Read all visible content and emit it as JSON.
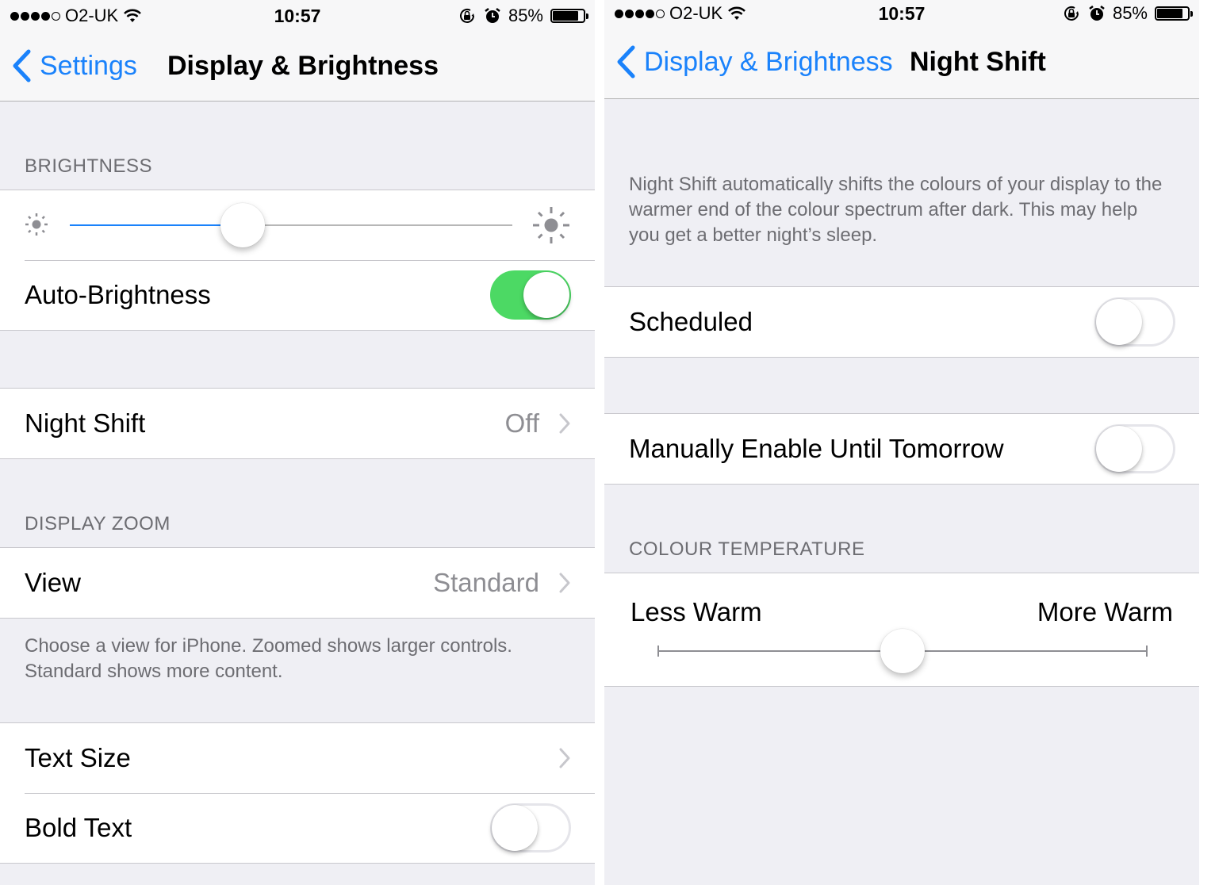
{
  "colors": {
    "accent": "#1a82fb",
    "toggle_on": "#4cd964",
    "background": "#efeff4",
    "secondary_text": "#8e8e93",
    "header_text": "#6d6d72"
  },
  "left_screen": {
    "status_bar": {
      "signal_bars": 4,
      "signal_max": 5,
      "carrier": "O2-UK",
      "wifi_icon": "wifi-icon",
      "time": "10:57",
      "rotation_lock_icon": "rotation-lock-icon",
      "alarm_icon": "alarm-icon",
      "battery_percent": "85%",
      "battery_level": 0.85
    },
    "nav": {
      "back_label": "Settings",
      "title": "Display & Brightness"
    },
    "brightness": {
      "header": "BRIGHTNESS",
      "slider_value": 0.39,
      "min_icon": "sun-small-icon",
      "max_icon": "sun-large-icon",
      "auto_brightness_label": "Auto-Brightness",
      "auto_brightness_on": true
    },
    "night_shift": {
      "label": "Night Shift",
      "value": "Off"
    },
    "display_zoom": {
      "header": "DISPLAY ZOOM",
      "view_label": "View",
      "view_value": "Standard",
      "footer": "Choose a view for iPhone. Zoomed shows larger controls. Standard shows more content."
    },
    "text": {
      "text_size_label": "Text Size",
      "bold_text_label": "Bold Text",
      "bold_text_on": false
    }
  },
  "right_screen": {
    "status_bar": {
      "signal_bars": 4,
      "signal_max": 5,
      "carrier": "O2-UK",
      "time": "10:57",
      "battery_percent": "85%",
      "battery_level": 0.85
    },
    "nav": {
      "back_label": "Display & Brightness",
      "title": "Night Shift"
    },
    "description": "Night Shift automatically shifts the colours of your display to the warmer end of the colour spectrum after dark. This may help you get a better night’s sleep.",
    "scheduled_label": "Scheduled",
    "scheduled_on": false,
    "manual_label": "Manually Enable Until Tomorrow",
    "manual_on": false,
    "colour_temperature": {
      "header": "COLOUR TEMPERATURE",
      "min_label": "Less Warm",
      "max_label": "More Warm",
      "value": 0.5
    }
  }
}
